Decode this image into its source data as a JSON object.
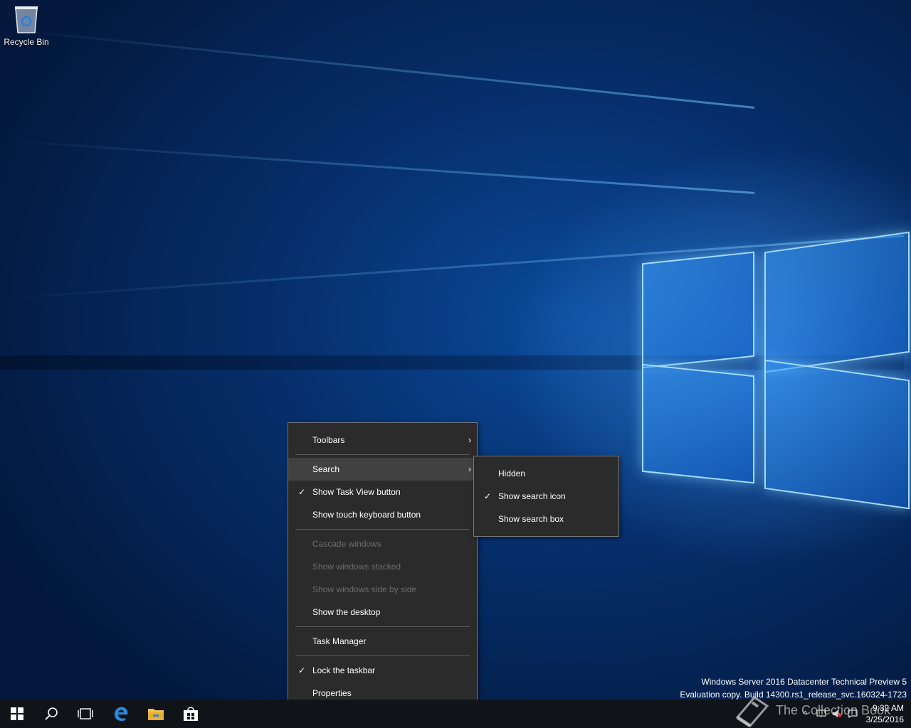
{
  "desktop": {
    "icons": [
      {
        "label": "Recycle Bin",
        "icon": "recycle-bin-icon"
      }
    ],
    "watermark": {
      "line1": "Windows Server 2016 Datacenter Technical Preview 5",
      "line2": "Evaluation copy. Build 14300.rs1_release_svc.160324-1723"
    }
  },
  "context_menu": {
    "toolbars": "Toolbars",
    "search": "Search",
    "show_task_view": "Show Task View button",
    "show_touch_keyboard": "Show touch keyboard button",
    "cascade": "Cascade windows",
    "stacked": "Show windows stacked",
    "side_by_side": "Show windows side by side",
    "show_desktop": "Show the desktop",
    "task_manager": "Task Manager",
    "lock_taskbar": "Lock the taskbar",
    "properties": "Properties",
    "check_mark": "✓",
    "submenu_arrow": "›"
  },
  "search_submenu": {
    "hidden": "Hidden",
    "show_icon": "Show search icon",
    "show_box": "Show search box",
    "check_mark": "✓"
  },
  "taskbar": {
    "time": "9:32 AM",
    "date": "3/25/2016",
    "overlay_text": "The Collection Book",
    "tray_chevron": "^"
  }
}
